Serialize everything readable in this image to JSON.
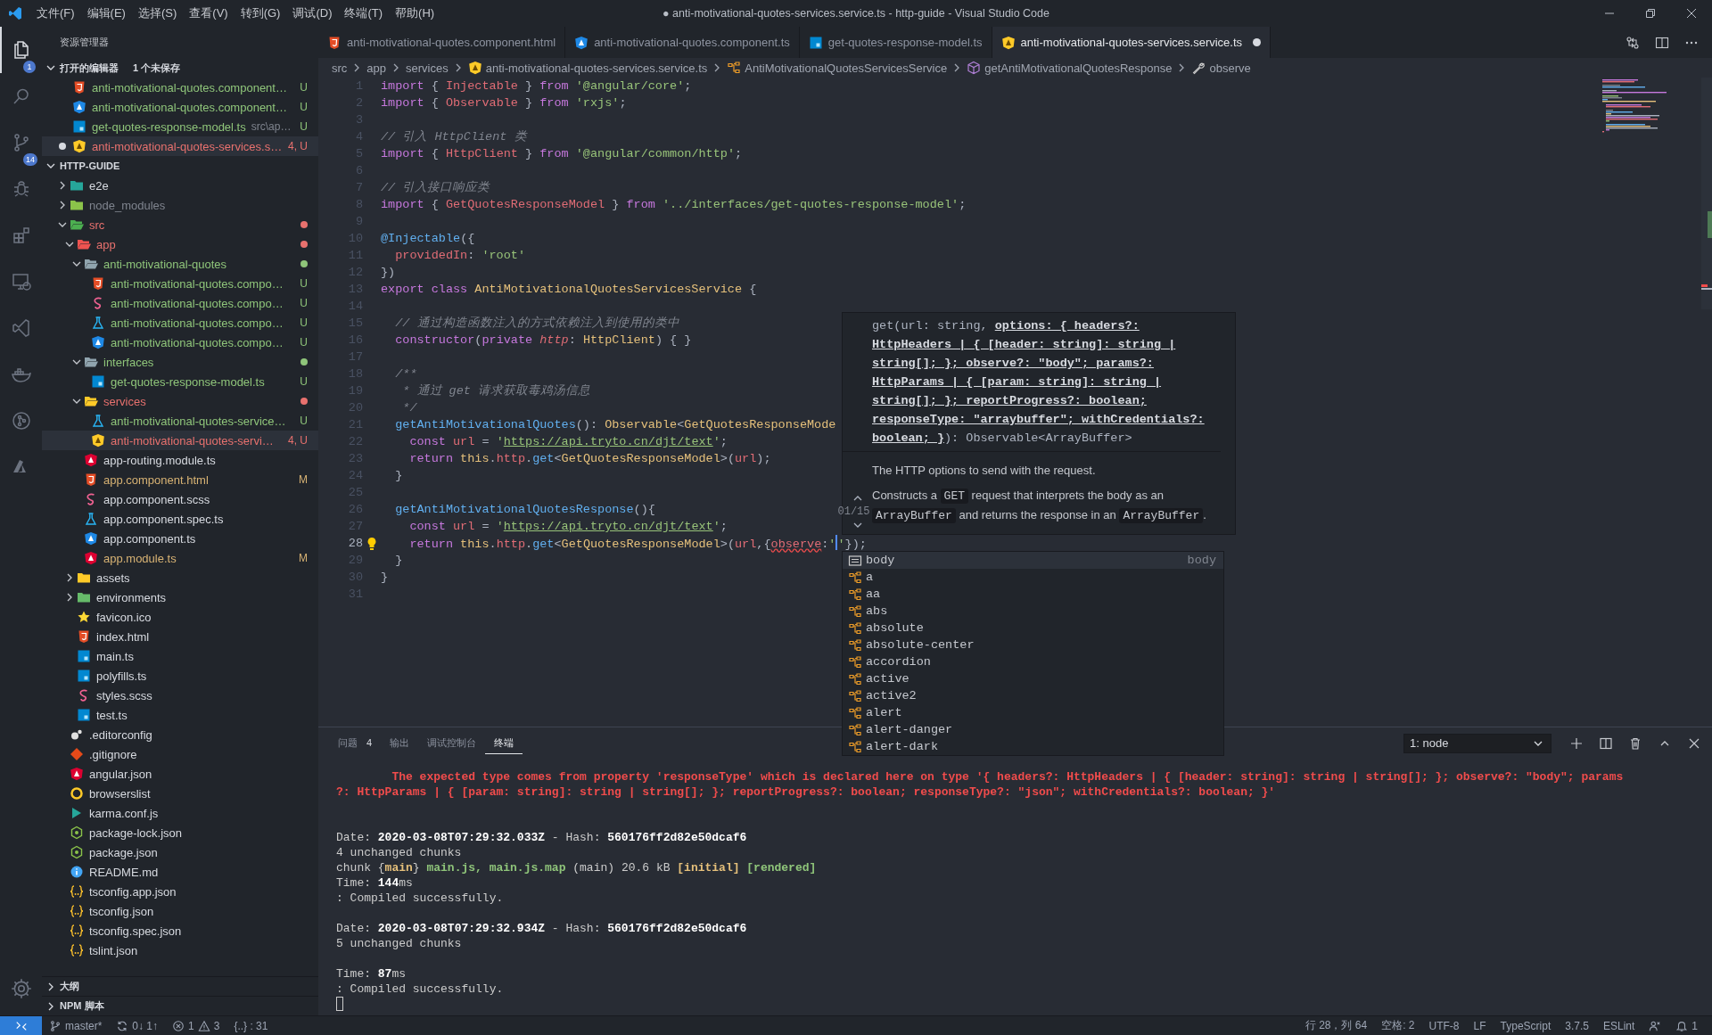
{
  "window": {
    "title": "● anti-motivational-quotes-services.service.ts - http-guide - Visual Studio Code"
  },
  "menu": [
    "文件(F)",
    "编辑(E)",
    "选择(S)",
    "查看(V)",
    "转到(G)",
    "调试(D)",
    "终端(T)",
    "帮助(H)"
  ],
  "activity_bar": {
    "items": [
      {
        "kind": "explorer",
        "selected": true,
        "badge": "1"
      },
      {
        "kind": "search",
        "selected": false
      },
      {
        "kind": "source-control",
        "selected": false,
        "badge": "14"
      },
      {
        "kind": "debug",
        "selected": false
      },
      {
        "kind": "extensions",
        "selected": false
      },
      {
        "kind": "remote",
        "selected": false
      },
      {
        "kind": "live-share",
        "selected": false
      },
      {
        "kind": "docker",
        "selected": false
      },
      {
        "kind": "git-graph",
        "selected": false
      },
      {
        "kind": "azure",
        "selected": false
      }
    ]
  },
  "sidebar": {
    "title": "资源管理器",
    "open_editors": {
      "title": "打开的编辑器",
      "note": "1 个未保存",
      "expanded": true,
      "items": [
        {
          "kind": "html",
          "label": "anti-motivational-quotes.component…",
          "color": "#8fc57a",
          "badge": "U",
          "dirty": false,
          "selected": false
        },
        {
          "kind": "ng-blue",
          "label": "anti-motivational-quotes.component…",
          "color": "#8fc57a",
          "badge": "U",
          "dirty": false,
          "selected": false
        },
        {
          "kind": "ts",
          "label": "get-quotes-response-model.ts",
          "description": "src\\ap…",
          "color": "#8fc57a",
          "badge": "U",
          "dirty": false,
          "selected": false
        },
        {
          "kind": "ng-yellow",
          "label": "anti-motivational-quotes-services.s…",
          "color": "#e8716e",
          "badge": "4, U",
          "dirty": true,
          "selected": true
        }
      ]
    },
    "folder": {
      "title": "HTTP-GUIDE",
      "expanded": true,
      "tree": [
        {
          "label": "e2e",
          "kind": "folder-e2e",
          "expanded": false,
          "selected": false
        },
        {
          "label": "node_modules",
          "kind": "folder-node",
          "color": "#7f848e",
          "expanded": false,
          "selected": false
        },
        {
          "label": "src",
          "kind": "folder-src",
          "color": "#e8716e",
          "expanded": true,
          "selected": false,
          "children": [
            {
              "label": "app",
              "kind": "folder-app",
              "color": "#e8716e",
              "expanded": true,
              "selected": false,
              "children": [
                {
                  "label": "anti-motivational-quotes",
                  "kind": "folder",
                  "color": "#8fc57a",
                  "expanded": true,
                  "selected": false,
                  "children": [
                    {
                      "label": "anti-motivational-quotes.compo…",
                      "kind": "html",
                      "color": "#8fc57a",
                      "badge": "U",
                      "selected": false
                    },
                    {
                      "label": "anti-motivational-quotes.compo…",
                      "kind": "scss",
                      "color": "#8fc57a",
                      "badge": "U",
                      "selected": false
                    },
                    {
                      "label": "anti-motivational-quotes.compo…",
                      "kind": "spec",
                      "color": "#8fc57a",
                      "badge": "U",
                      "selected": false
                    },
                    {
                      "label": "anti-motivational-quotes.compo…",
                      "kind": "ng-blue",
                      "color": "#8fc57a",
                      "badge": "U",
                      "selected": false
                    }
                  ]
                },
                {
                  "label": "interfaces",
                  "kind": "folder",
                  "color": "#8fc57a",
                  "expanded": true,
                  "selected": false,
                  "children": [
                    {
                      "label": "get-quotes-response-model.ts",
                      "kind": "ts",
                      "color": "#8fc57a",
                      "badge": "U",
                      "selected": false
                    }
                  ]
                },
                {
                  "label": "services",
                  "kind": "folder-services",
                  "color": "#e8716e",
                  "expanded": true,
                  "selected": false,
                  "children": [
                    {
                      "label": "anti-motivational-quotes-service…",
                      "kind": "spec",
                      "color": "#8fc57a",
                      "badge": "U",
                      "selected": false
                    },
                    {
                      "label": "anti-motivational-quotes-servi…",
                      "kind": "ng-yellow",
                      "color": "#e8716e",
                      "badge": "4, U",
                      "selected": true
                    }
                  ]
                },
                {
                  "label": "app-routing.module.ts",
                  "kind": "ng-red",
                  "selected": false
                },
                {
                  "label": "app.component.html",
                  "kind": "html",
                  "color": "#d8b374",
                  "badge": "M",
                  "selected": false
                },
                {
                  "label": "app.component.scss",
                  "kind": "scss",
                  "selected": false
                },
                {
                  "label": "app.component.spec.ts",
                  "kind": "spec",
                  "selected": false
                },
                {
                  "label": "app.component.ts",
                  "kind": "ng-blue",
                  "selected": false
                },
                {
                  "label": "app.module.ts",
                  "kind": "ng-red",
                  "color": "#d8b374",
                  "badge": "M",
                  "selected": false
                }
              ]
            },
            {
              "label": "assets",
              "kind": "folder-assets",
              "expanded": false,
              "selected": false
            },
            {
              "label": "environments",
              "kind": "folder-env",
              "expanded": false,
              "selected": false
            },
            {
              "label": "favicon.ico",
              "kind": "star",
              "selected": false
            },
            {
              "label": "index.html",
              "kind": "html",
              "selected": false
            },
            {
              "label": "main.ts",
              "kind": "ts",
              "selected": false
            },
            {
              "label": "polyfills.ts",
              "kind": "ts",
              "selected": false
            },
            {
              "label": "styles.scss",
              "kind": "scss",
              "selected": false
            },
            {
              "label": "test.ts",
              "kind": "ts",
              "selected": false
            }
          ]
        },
        {
          "label": ".editorconfig",
          "kind": "editorconfig",
          "selected": false
        },
        {
          "label": ".gitignore",
          "kind": "git",
          "selected": false
        },
        {
          "label": "angular.json",
          "kind": "ng-red",
          "selected": false
        },
        {
          "label": "browserslist",
          "kind": "browserslist",
          "selected": false
        },
        {
          "label": "karma.conf.js",
          "kind": "karma",
          "selected": false
        },
        {
          "label": "package-lock.json",
          "kind": "node",
          "selected": false
        },
        {
          "label": "package.json",
          "kind": "node",
          "selected": false
        },
        {
          "label": "README.md",
          "kind": "info",
          "selected": false
        },
        {
          "label": "tsconfig.app.json",
          "kind": "json",
          "selected": false
        },
        {
          "label": "tsconfig.json",
          "kind": "json",
          "selected": false
        },
        {
          "label": "tsconfig.spec.json",
          "kind": "json",
          "selected": false
        },
        {
          "label": "tslint.json",
          "kind": "json",
          "selected": false
        }
      ]
    },
    "sections": [
      {
        "title": "大纲",
        "expanded": false
      },
      {
        "title": "NPM 脚本",
        "expanded": false
      }
    ]
  },
  "editor": {
    "tabs": [
      {
        "kind": "html",
        "label": "anti-motivational-quotes.component.html",
        "selected": false,
        "dirty": false
      },
      {
        "kind": "ng-blue",
        "label": "anti-motivational-quotes.component.ts",
        "selected": false,
        "dirty": false
      },
      {
        "kind": "ts",
        "label": "get-quotes-response-model.ts",
        "selected": false,
        "dirty": false
      },
      {
        "kind": "ng-yellow",
        "label": "anti-motivational-quotes-services.service.ts",
        "selected": true,
        "dirty": true
      }
    ],
    "breadcrumbs": [
      {
        "label": "src"
      },
      {
        "label": "app"
      },
      {
        "label": "services"
      },
      {
        "kind": "ng-yellow",
        "label": "anti-motivational-quotes-services.service.ts"
      },
      {
        "kind": "class",
        "label": "AntiMotivationalQuotesServicesService"
      },
      {
        "kind": "method",
        "label": "getAntiMotivationalQuotesResponse"
      },
      {
        "kind": "wrench",
        "label": "observe"
      }
    ],
    "lines": [
      {
        "number": "1",
        "current": false,
        "tokens": [
          {
            "kind": "keyword",
            "text": "import"
          },
          {
            "kind": "punct",
            "text": " { "
          },
          {
            "kind": "type",
            "text": "Injectable"
          },
          {
            "kind": "punct",
            "text": " } "
          },
          {
            "kind": "keyword",
            "text": "from"
          },
          {
            "kind": "string",
            "text": " '@angular/core'"
          },
          {
            "kind": "punct",
            "text": ";"
          }
        ]
      },
      {
        "number": "2",
        "current": false,
        "tokens": [
          {
            "kind": "keyword",
            "text": "import"
          },
          {
            "kind": "punct",
            "text": " { "
          },
          {
            "kind": "type",
            "text": "Observable"
          },
          {
            "kind": "punct",
            "text": " } "
          },
          {
            "kind": "keyword",
            "text": "from"
          },
          {
            "kind": "string",
            "text": " 'rxjs'"
          },
          {
            "kind": "punct",
            "text": ";"
          }
        ]
      },
      {
        "number": "3",
        "current": false
      },
      {
        "number": "4",
        "current": false,
        "tokens": [
          {
            "kind": "comment",
            "text": "// 引入 HttpClient 类"
          }
        ]
      },
      {
        "number": "5",
        "current": false,
        "tokens": [
          {
            "kind": "keyword",
            "text": "import"
          },
          {
            "kind": "punct",
            "text": " { "
          },
          {
            "kind": "type",
            "text": "HttpClient"
          },
          {
            "kind": "punct",
            "text": " } "
          },
          {
            "kind": "keyword",
            "text": "from"
          },
          {
            "kind": "string",
            "text": " '@angular/common/http'"
          },
          {
            "kind": "punct",
            "text": ";"
          }
        ]
      },
      {
        "number": "6",
        "current": false
      },
      {
        "number": "7",
        "current": false,
        "tokens": [
          {
            "kind": "comment",
            "text": "// 引入接口响应类"
          }
        ]
      },
      {
        "number": "8",
        "current": false,
        "tokens": [
          {
            "kind": "keyword",
            "text": "import"
          },
          {
            "kind": "punct",
            "text": " { "
          },
          {
            "kind": "type",
            "text": "GetQuotesResponseModel"
          },
          {
            "kind": "punct",
            "text": " } "
          },
          {
            "kind": "keyword",
            "text": "from"
          },
          {
            "kind": "string",
            "text": " '../interfaces/get-quotes-response-model'"
          },
          {
            "kind": "punct",
            "text": ";"
          }
        ]
      },
      {
        "number": "9",
        "current": false
      },
      {
        "number": "10",
        "current": false,
        "tokens": [
          {
            "kind": "function",
            "text": "@Injectable"
          },
          {
            "kind": "punct",
            "text": "({"
          }
        ]
      },
      {
        "number": "11",
        "current": false,
        "tokens": [
          {
            "kind": "property",
            "text": "  providedIn"
          },
          {
            "kind": "punct",
            "text": ": "
          },
          {
            "kind": "string",
            "text": "'root'"
          }
        ]
      },
      {
        "number": "12",
        "current": false,
        "tokens": [
          {
            "kind": "punct",
            "text": "})"
          }
        ]
      },
      {
        "number": "13",
        "current": false,
        "tokens": [
          {
            "kind": "keyword",
            "text": "export"
          },
          {
            "kind": "keyword",
            "text": " class"
          },
          {
            "kind": "class",
            "text": " AntiMotivationalQuotesServicesService"
          },
          {
            "kind": "punct",
            "text": " {"
          }
        ]
      },
      {
        "number": "14",
        "current": false
      },
      {
        "number": "15",
        "current": false,
        "tokens": [
          {
            "kind": "comment",
            "text": "  // 通过构造函数注入的方式依赖注入到使用的类中"
          }
        ]
      },
      {
        "number": "16",
        "current": false,
        "tokens": [
          {
            "kind": "keyword",
            "text": "  constructor"
          },
          {
            "kind": "punct",
            "text": "("
          },
          {
            "kind": "keyword",
            "text": "private"
          },
          {
            "kind": "parameter",
            "text": " http"
          },
          {
            "kind": "punct",
            "text": ": "
          },
          {
            "kind": "class",
            "text": "HttpClient"
          },
          {
            "kind": "punct",
            "text": ") { }"
          }
        ]
      },
      {
        "number": "17",
        "current": false
      },
      {
        "number": "18",
        "current": false,
        "tokens": [
          {
            "kind": "comment",
            "text": "  /**"
          }
        ]
      },
      {
        "number": "19",
        "current": false,
        "tokens": [
          {
            "kind": "comment",
            "text": "   * 通过 get 请求获取毒鸡汤信息"
          }
        ]
      },
      {
        "number": "20",
        "current": false,
        "tokens": [
          {
            "kind": "comment",
            "text": "   */"
          }
        ]
      },
      {
        "number": "21",
        "current": false,
        "tokens": [
          {
            "kind": "function",
            "text": "  getAntiMotivationalQuotes"
          },
          {
            "kind": "punct",
            "text": "(): "
          },
          {
            "kind": "class",
            "text": "Observable"
          },
          {
            "kind": "punct",
            "text": "<"
          },
          {
            "kind": "class",
            "text": "GetQuotesResponseMode"
          }
        ]
      },
      {
        "number": "22",
        "current": false,
        "tokens": [
          {
            "kind": "keyword",
            "text": "    const"
          },
          {
            "kind": "variable",
            "text": " url"
          },
          {
            "kind": "punct",
            "text": " = "
          },
          {
            "kind": "string",
            "text": "'"
          },
          {
            "kind": "link",
            "text": "https://api.tryto.cn/djt/text"
          },
          {
            "kind": "string",
            "text": "'"
          },
          {
            "kind": "punct",
            "text": ";"
          }
        ]
      },
      {
        "number": "23",
        "current": false,
        "tokens": [
          {
            "kind": "keyword",
            "text": "    return"
          },
          {
            "kind": "class",
            "text": " this"
          },
          {
            "kind": "punct",
            "text": "."
          },
          {
            "kind": "property",
            "text": "http"
          },
          {
            "kind": "punct",
            "text": "."
          },
          {
            "kind": "function",
            "text": "get"
          },
          {
            "kind": "punct",
            "text": "<"
          },
          {
            "kind": "class",
            "text": "GetQuotesResponseModel"
          },
          {
            "kind": "punct",
            "text": ">("
          },
          {
            "kind": "property",
            "text": "url"
          },
          {
            "kind": "punct",
            "text": ");"
          }
        ]
      },
      {
        "number": "24",
        "current": false,
        "tokens": [
          {
            "kind": "punct",
            "text": "  }"
          }
        ]
      },
      {
        "number": "25",
        "current": false
      },
      {
        "number": "26",
        "current": false,
        "tokens": [
          {
            "kind": "function",
            "text": "  getAntiMotivationalQuotesResponse"
          },
          {
            "kind": "punct",
            "text": "(){"
          }
        ]
      },
      {
        "number": "27",
        "current": false,
        "tokens": [
          {
            "kind": "keyword",
            "text": "    const"
          },
          {
            "kind": "variable",
            "text": " url"
          },
          {
            "kind": "punct",
            "text": " = "
          },
          {
            "kind": "string",
            "text": "'"
          },
          {
            "kind": "link",
            "text": "https://api.tryto.cn/djt/text"
          },
          {
            "kind": "string",
            "text": "'"
          },
          {
            "kind": "punct",
            "text": ";"
          }
        ]
      },
      {
        "number": "28",
        "current": true,
        "tokens": [
          {
            "kind": "keyword",
            "text": "    return"
          },
          {
            "kind": "class",
            "text": " this"
          },
          {
            "kind": "punct",
            "text": "."
          },
          {
            "kind": "property",
            "text": "http"
          },
          {
            "kind": "punct",
            "text": "."
          },
          {
            "kind": "function",
            "text": "get"
          },
          {
            "kind": "punct",
            "text": "<"
          },
          {
            "kind": "class",
            "text": "GetQuotesResponseModel"
          },
          {
            "kind": "punct",
            "text": ">("
          },
          {
            "kind": "property",
            "text": "url"
          },
          {
            "kind": "punct",
            "text": ",{"
          },
          {
            "kind": "property-error",
            "text": "observe"
          },
          {
            "kind": "punct",
            "text": ":"
          },
          {
            "kind": "string",
            "text": "'"
          },
          {
            "kind": "cursor"
          },
          {
            "kind": "string",
            "text": "'"
          },
          {
            "kind": "punct",
            "text": "});"
          }
        ]
      },
      {
        "number": "29",
        "current": false,
        "tokens": [
          {
            "kind": "punct",
            "text": "  }"
          }
        ]
      },
      {
        "number": "30",
        "current": false,
        "tokens": [
          {
            "kind": "punct",
            "text": "}"
          }
        ]
      },
      {
        "number": "31",
        "current": false
      }
    ]
  },
  "hover": {
    "overload": "01/15",
    "signature": "get(url: string, **options: { headers?: HttpHeaders | { [header: string]: string | string[]; }; observe?: \"body\"; params?: HttpParams | { [param: string]: string | string[]; }; reportProgress?: boolean; responseType: \"arraybuffer\"; withCredentials?: boolean; }**): Observable<ArrayBuffer>",
    "docs": [
      {
        "parts": [
          {
            "kind": "text",
            "text": "The HTTP options to send with the request."
          }
        ]
      },
      {
        "parts": [
          {
            "kind": "text",
            "text": "Constructs a "
          },
          {
            "kind": "code",
            "text": "GET"
          },
          {
            "kind": "text",
            "text": " request that interprets the body as an "
          },
          {
            "kind": "code",
            "text": "ArrayBuffer"
          },
          {
            "kind": "text",
            "text": " and returns the response in an "
          },
          {
            "kind": "code",
            "text": "ArrayBuffer"
          },
          {
            "kind": "text",
            "text": "."
          }
        ]
      }
    ]
  },
  "suggest": {
    "items": [
      {
        "kind": "property",
        "label": "body",
        "detail": "body",
        "selected": true
      },
      {
        "kind": "snippet",
        "label": "a",
        "selected": false
      },
      {
        "kind": "snippet",
        "label": "aa",
        "selected": false
      },
      {
        "kind": "snippet",
        "label": "abs",
        "selected": false
      },
      {
        "kind": "snippet",
        "label": "absolute",
        "selected": false
      },
      {
        "kind": "snippet",
        "label": "absolute-center",
        "selected": false
      },
      {
        "kind": "snippet",
        "label": "accordion",
        "selected": false
      },
      {
        "kind": "snippet",
        "label": "active",
        "selected": false
      },
      {
        "kind": "snippet",
        "label": "active2",
        "selected": false
      },
      {
        "kind": "snippet",
        "label": "alert",
        "selected": false
      },
      {
        "kind": "snippet",
        "label": "alert-danger",
        "selected": false
      },
      {
        "kind": "snippet",
        "label": "alert-dark",
        "selected": false
      }
    ]
  },
  "panel": {
    "tabs": [
      {
        "label": "问题",
        "count": "4",
        "selected": false
      },
      {
        "label": "输出",
        "selected": false
      },
      {
        "label": "调试控制台",
        "selected": false
      },
      {
        "label": "终端",
        "selected": true
      }
    ],
    "terminal_select": "1: node",
    "terminal": [
      {
        "kind": "text",
        "spans": [
          {
            "kind": "error",
            "text": "        The expected type comes from property 'responseType' which is declared here on type '{ headers?: HttpHeaders | { [header: string]: string | string[]; }; observe?: \"body\"; params"
          }
        ]
      },
      {
        "kind": "text",
        "spans": [
          {
            "kind": "error",
            "text": "?: HttpParams | { [param: string]: string | string[]; }; reportProgress?: boolean; responseType?: \"json\"; withCredentials?: boolean; }'"
          }
        ]
      },
      {
        "kind": "blank"
      },
      {
        "kind": "blank"
      },
      {
        "kind": "text",
        "spans": [
          {
            "kind": "plain",
            "text": "Date: "
          },
          {
            "kind": "bold",
            "text": "2020-03-08T07:29:32.033Z"
          },
          {
            "kind": "plain",
            "text": " - Hash: "
          },
          {
            "kind": "bold",
            "text": "560176ff2d82e50dcaf6"
          }
        ]
      },
      {
        "kind": "text",
        "spans": [
          {
            "kind": "plain",
            "text": "4 unchanged chunks"
          }
        ]
      },
      {
        "kind": "text",
        "spans": [
          {
            "kind": "plain",
            "text": "chunk {"
          },
          {
            "kind": "yellow",
            "text": "main"
          },
          {
            "kind": "plain",
            "text": "} "
          },
          {
            "kind": "green",
            "text": "main.js, main.js.map"
          },
          {
            "kind": "plain",
            "text": " (main) 20.6 kB "
          },
          {
            "kind": "yellow",
            "text": "[initial]"
          },
          {
            "kind": "green",
            "text": " [rendered]"
          }
        ]
      },
      {
        "kind": "text",
        "spans": [
          {
            "kind": "plain",
            "text": "Time: "
          },
          {
            "kind": "bold",
            "text": "144"
          },
          {
            "kind": "plain",
            "text": "ms"
          }
        ]
      },
      {
        "kind": "text",
        "spans": [
          {
            "kind": "plain",
            "text": ": Compiled successfully."
          }
        ]
      },
      {
        "kind": "blank"
      },
      {
        "kind": "text",
        "spans": [
          {
            "kind": "plain",
            "text": "Date: "
          },
          {
            "kind": "bold",
            "text": "2020-03-08T07:29:32.934Z"
          },
          {
            "kind": "plain",
            "text": " - Hash: "
          },
          {
            "kind": "bold",
            "text": "560176ff2d82e50dcaf6"
          }
        ]
      },
      {
        "kind": "text",
        "spans": [
          {
            "kind": "plain",
            "text": "5 unchanged chunks"
          }
        ]
      },
      {
        "kind": "blank"
      },
      {
        "kind": "text",
        "spans": [
          {
            "kind": "plain",
            "text": "Time: "
          },
          {
            "kind": "bold",
            "text": "87"
          },
          {
            "kind": "plain",
            "text": "ms"
          }
        ]
      },
      {
        "kind": "text",
        "spans": [
          {
            "kind": "plain",
            "text": ": Compiled successfully."
          }
        ]
      },
      {
        "kind": "cursor"
      }
    ]
  },
  "status_bar": {
    "left": [
      {
        "kind": "remote"
      },
      {
        "kind": "branch",
        "text": "master*"
      },
      {
        "kind": "sync",
        "text": "0↓ 1↑"
      },
      {
        "kind": "problems",
        "errors": "1",
        "warnings": "3"
      },
      {
        "kind": "text",
        "text": "{..} : 31"
      }
    ],
    "right": [
      {
        "kind": "text",
        "text": "行 28，列 64"
      },
      {
        "kind": "text",
        "text": "空格: 2"
      },
      {
        "kind": "text",
        "text": "UTF-8"
      },
      {
        "kind": "text",
        "text": "LF"
      },
      {
        "kind": "text",
        "text": "TypeScript"
      },
      {
        "kind": "text",
        "text": "3.7.5"
      },
      {
        "kind": "text",
        "text": "ESLint"
      },
      {
        "kind": "feedback"
      },
      {
        "kind": "notifications",
        "text": "1"
      }
    ]
  }
}
